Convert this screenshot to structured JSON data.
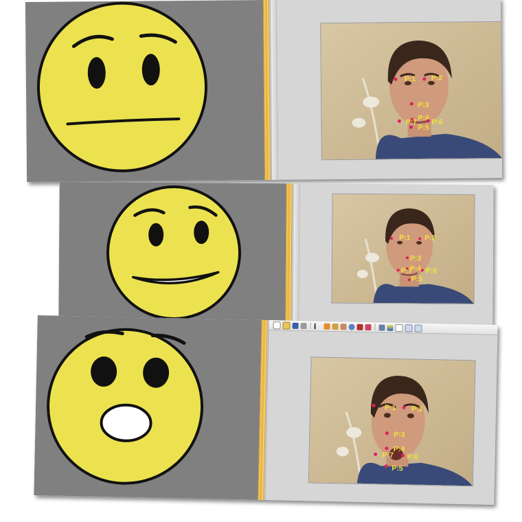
{
  "colors": {
    "face_yellow": "#ece24f",
    "avatar_background": "#808080",
    "point_marker": "#e0205a",
    "point_label": "#f2e23a"
  },
  "panels": [
    {
      "expression": "neutral",
      "landmarks": [
        "P:1",
        "P:2",
        "P:3",
        "P:4",
        "P:5",
        "P:6",
        "P:7"
      ]
    },
    {
      "expression": "slight-smile",
      "landmarks": [
        "P:1",
        "P:2",
        "P:3",
        "P:4",
        "P:5",
        "P:6",
        "P:7"
      ]
    },
    {
      "expression": "surprised",
      "landmarks": [
        "P:1",
        "P:2",
        "P:3",
        "P:4",
        "P:5",
        "P:6",
        "P:7"
      ]
    }
  ],
  "toolbar_icons": [
    "new-icon",
    "open-icon",
    "save-icon",
    "print-icon",
    "pointer-icon",
    "zoom-in-icon",
    "zoom-out-icon",
    "pan-icon",
    "rotate-icon",
    "data-cursor-icon",
    "brush-icon",
    "link-icon",
    "colorbar-icon",
    "legend-icon",
    "hide-icon",
    "show-icon"
  ]
}
